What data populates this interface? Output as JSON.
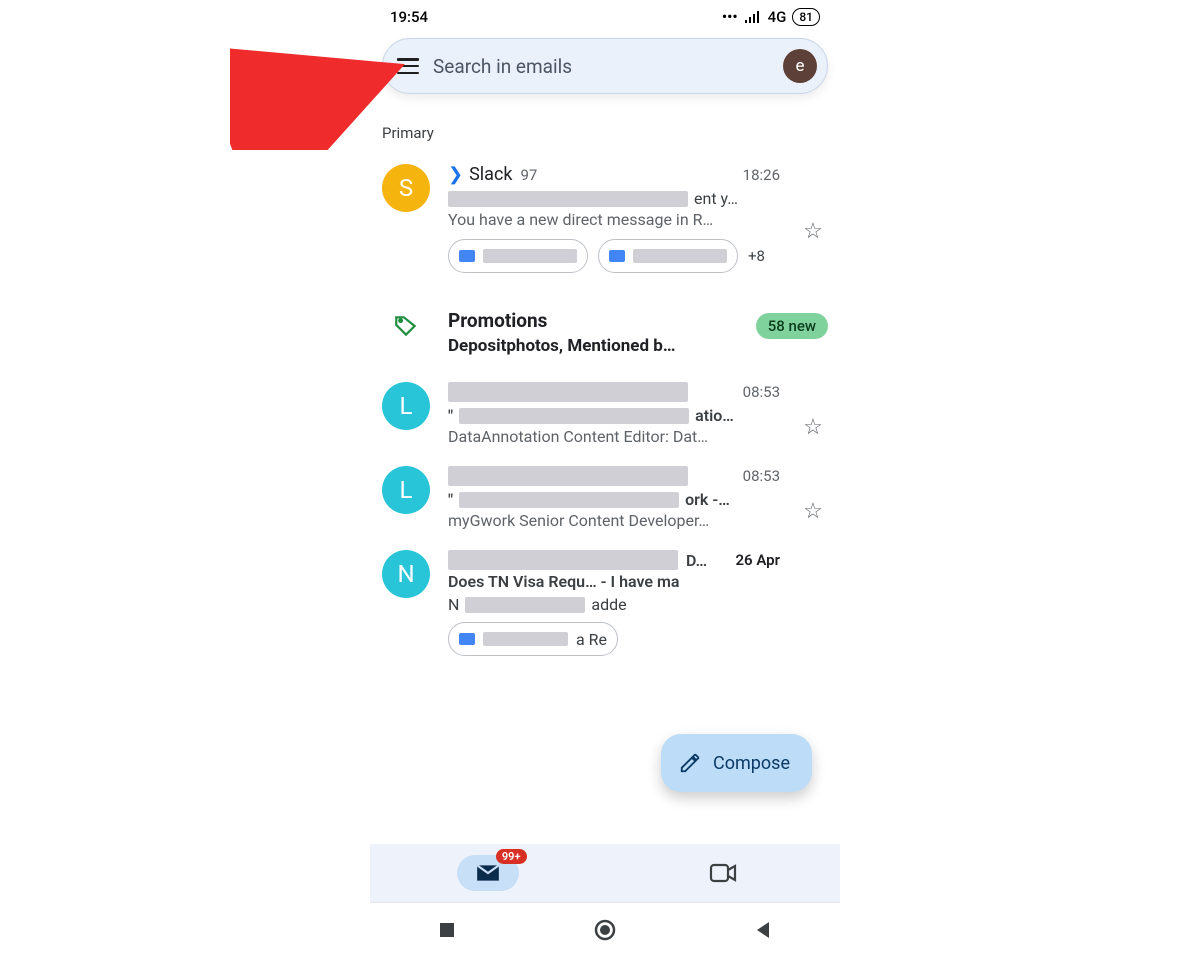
{
  "status": {
    "time": "19:54",
    "network": "4G",
    "battery": "81"
  },
  "search": {
    "placeholder": "Search in emails",
    "avatar_letter": "e"
  },
  "section_label": "Primary",
  "emails": [
    {
      "avatar_letter": "S",
      "sender": "Slack",
      "count": "97",
      "time": "18:26",
      "subject_suffix": "ent y…",
      "preview": "You have a new direct message in R…",
      "chips_more": "+8"
    },
    {
      "avatar_letter": "L",
      "time": "08:53",
      "subject_suffix": "atio…",
      "preview": "DataAnnotation Content Editor: Dat…"
    },
    {
      "avatar_letter": "L",
      "time": "08:53",
      "subject_suffix": "ork -…",
      "preview": "myGwork Senior Content Developer…"
    },
    {
      "avatar_letter": "N",
      "time": "26 Apr",
      "sender_suffix": " D…",
      "subject": "Does TN Visa Requ… - I have ma",
      "preview_suffix": "adde",
      "chip_suffix": "a Re"
    }
  ],
  "promotions": {
    "title": "Promotions",
    "subtitle": "Depositphotos, Mentioned b…",
    "badge": "58 new"
  },
  "compose_label": "Compose",
  "bottom": {
    "badge": "99+"
  }
}
